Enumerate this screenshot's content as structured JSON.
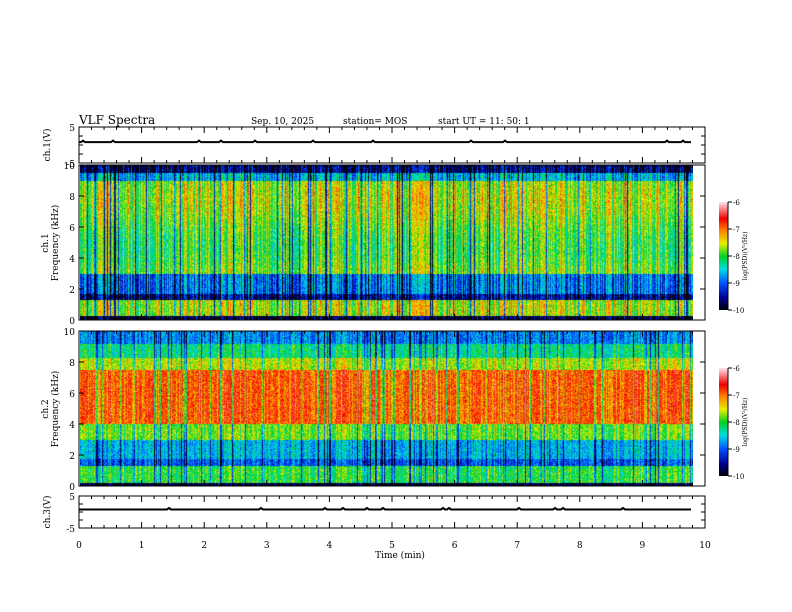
{
  "header": {
    "title": "VLF Spectra",
    "date": "Sep. 10, 2025",
    "station": "station= MOS",
    "start": "start  UT =   11: 50: 1"
  },
  "chart_data": [
    {
      "type": "line",
      "ylabel": "ch.1(V)",
      "ylim": [
        -5,
        5
      ],
      "yticks": [
        "5",
        "-5"
      ],
      "description_of_values": "near-constant trace slightly above 0"
    },
    {
      "type": "heatmap",
      "ylabel": "ch.1\nFrequency (kHz)",
      "ylabel_lines": [
        "ch.1",
        "Frequency (kHz)"
      ],
      "ylim": [
        0,
        10
      ],
      "yticks": [
        "0",
        "2",
        "4",
        "6",
        "8",
        "10"
      ],
      "x_data_end_min": 9.8,
      "colorbar": {
        "label": "log(PSD)(V²/Hz)",
        "range": [
          -10,
          -6
        ],
        "ticks": [
          "-6",
          "-7",
          "-8",
          "-9",
          "-10"
        ]
      }
    },
    {
      "type": "heatmap",
      "ylabel_lines": [
        "ch.2",
        "Frequency (kHz)"
      ],
      "ylim": [
        0,
        10
      ],
      "yticks": [
        "0",
        "2",
        "4",
        "6",
        "8",
        "10"
      ],
      "x_data_end_min": 9.8,
      "colorbar": {
        "label": "log(PSD)(V²/Hz)",
        "range": [
          -10,
          -6
        ],
        "ticks": [
          "-6",
          "-7",
          "-8",
          "-9",
          "-10"
        ]
      }
    },
    {
      "type": "line",
      "ylabel": "ch.3(V)",
      "ylim": [
        -5,
        5
      ],
      "yticks": [
        "5",
        "-5"
      ]
    }
  ],
  "xaxis": {
    "label": "Time  (min)",
    "range": [
      0,
      10
    ],
    "ticks": [
      "0",
      "1",
      "2",
      "3",
      "4",
      "5",
      "6",
      "7",
      "8",
      "9",
      "10"
    ]
  },
  "colors": {
    "low": "#000000",
    "high": "#ffe0e8"
  }
}
